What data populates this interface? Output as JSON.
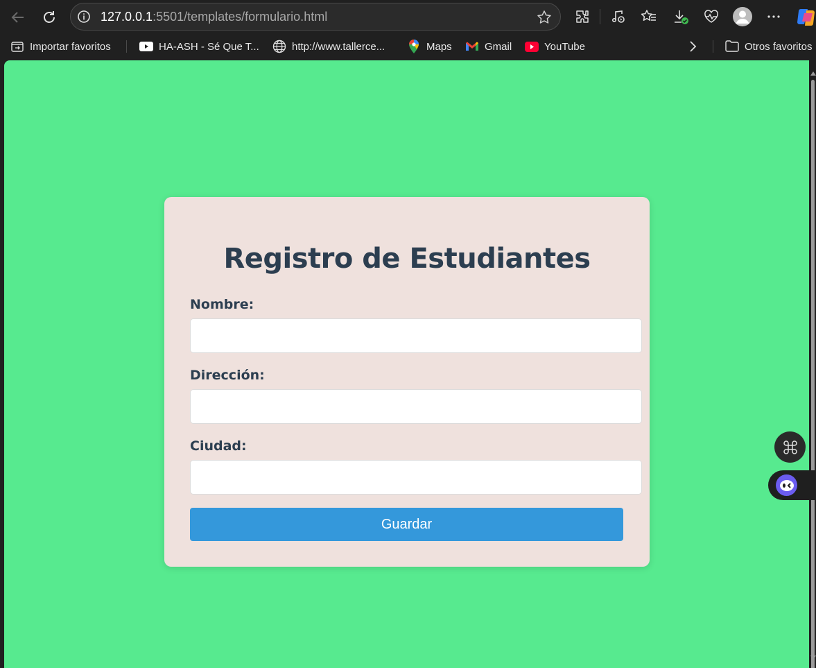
{
  "browser": {
    "url_host": "127.0.0.1",
    "url_rest": ":5501/templates/formulario.html",
    "icons": [
      "back-icon",
      "refresh-icon",
      "info-icon",
      "star-icon",
      "extensions-icon",
      "media-icon",
      "favorites-icon",
      "downloads-icon",
      "health-icon",
      "profile-icon",
      "more-icon",
      "copilot-icon"
    ]
  },
  "bookmarks": {
    "items": [
      {
        "label": "Importar favoritos",
        "icon": "import-icon"
      },
      {
        "label": "HA-ASH - Sé Que T...",
        "icon": "youtube-video-icon"
      },
      {
        "label": "http://www.tallerce...",
        "icon": "globe-icon"
      },
      {
        "label": "Maps",
        "icon": "maps-icon"
      },
      {
        "label": "Gmail",
        "icon": "gmail-icon"
      },
      {
        "label": "YouTube",
        "icon": "youtube-icon"
      }
    ],
    "other": "Otros favoritos"
  },
  "form": {
    "title": "Registro de Estudiantes",
    "fields": [
      {
        "label": "Nombre:",
        "value": ""
      },
      {
        "label": "Dirección:",
        "value": ""
      },
      {
        "label": "Ciudad:",
        "value": ""
      }
    ],
    "submit_label": "Guardar"
  },
  "colors": {
    "page_background": "#57ea8f",
    "card_background": "#efe1dd",
    "title_color": "#2c3e50",
    "button_color": "#3498db"
  }
}
